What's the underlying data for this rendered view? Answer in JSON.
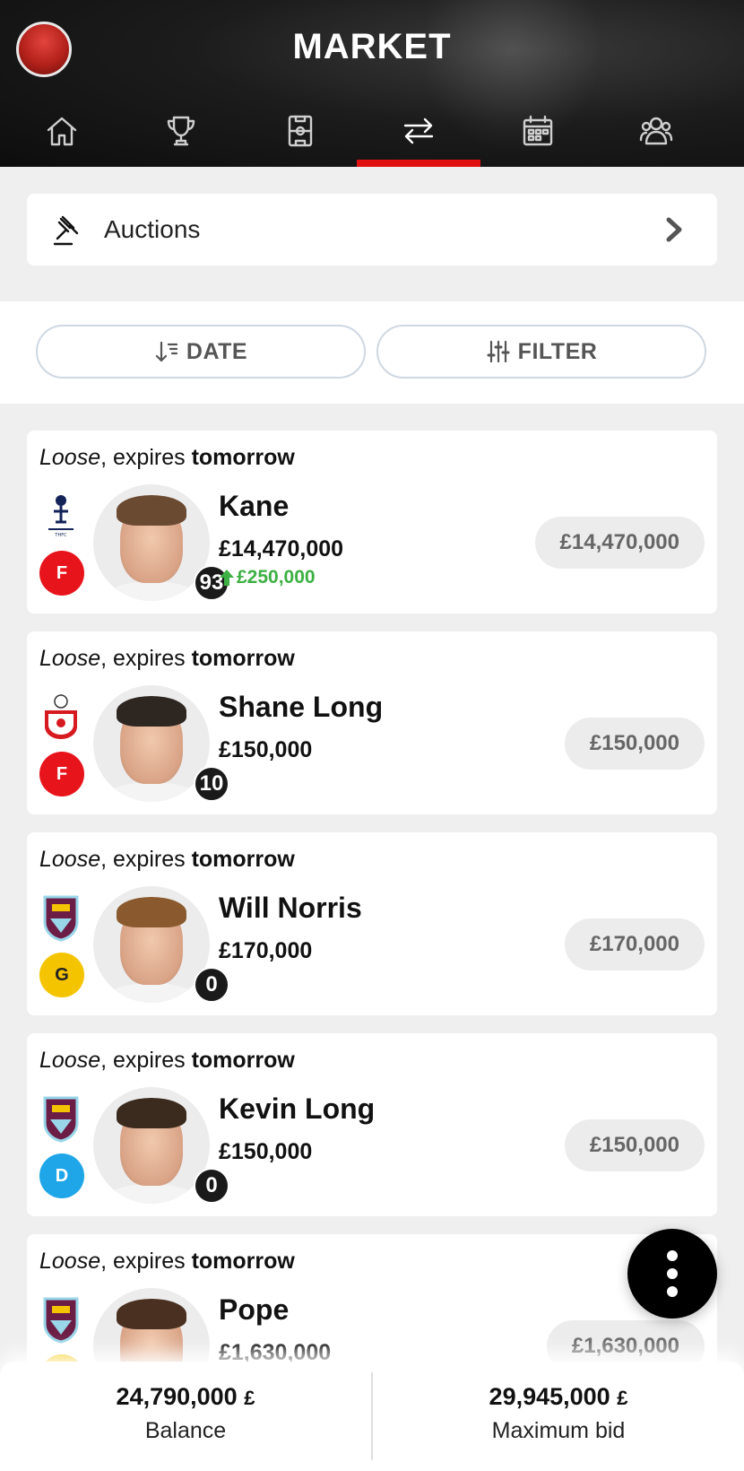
{
  "header": {
    "title": "MARKET",
    "tabs": [
      {
        "icon": "home-icon"
      },
      {
        "icon": "trophy-icon"
      },
      {
        "icon": "lineup-icon"
      },
      {
        "icon": "transfer-icon",
        "active": true
      },
      {
        "icon": "calendar-icon"
      },
      {
        "icon": "users-icon"
      }
    ]
  },
  "auctions": {
    "label": "Auctions",
    "icon": "gavel-icon"
  },
  "toolbar": {
    "sort_label": "DATE",
    "filter_label": "FILTER"
  },
  "players": [
    {
      "status_type": "Loose",
      "status_mid": ", expires ",
      "status_when": "tomorrow",
      "club": "Tottenham Hotspur",
      "position": "F",
      "position_color": "#e8141b",
      "name": "Kane",
      "value": "£14,470,000",
      "change": "£250,000",
      "score": "93",
      "price": "£14,470,000"
    },
    {
      "status_type": "Loose",
      "status_mid": ", expires ",
      "status_when": "tomorrow",
      "club": "Southampton",
      "position": "F",
      "position_color": "#e8141b",
      "name": "Shane Long",
      "value": "£150,000",
      "score": "10",
      "price": "£150,000"
    },
    {
      "status_type": "Loose",
      "status_mid": ", expires ",
      "status_when": "tomorrow",
      "club": "Burnley",
      "position": "G",
      "position_color": "#f5c400",
      "name": "Will Norris",
      "value": "£170,000",
      "score": "0",
      "price": "£170,000"
    },
    {
      "status_type": "Loose",
      "status_mid": ", expires ",
      "status_when": "tomorrow",
      "club": "Burnley",
      "position": "D",
      "position_color": "#1ea6e8",
      "name": "Kevin Long",
      "value": "£150,000",
      "score": "0",
      "price": "£150,000"
    },
    {
      "status_type": "Loose",
      "status_mid": ", expires ",
      "status_when": "tomorrow",
      "club": "Burnley",
      "position": "G",
      "position_color": "#f5c400",
      "name": "Pope",
      "value": "£1,630,000",
      "price": "£1,630,000"
    }
  ],
  "footer": {
    "balance_value": "24,790,000",
    "balance_currency": "£",
    "balance_label": "Balance",
    "max_bid_value": "29,945,000",
    "max_bid_currency": "£",
    "max_bid_label": "Maximum bid"
  },
  "colors": {
    "accent": "#e01010",
    "positive": "#3cb043",
    "header_bg": "#1a1a1a"
  }
}
